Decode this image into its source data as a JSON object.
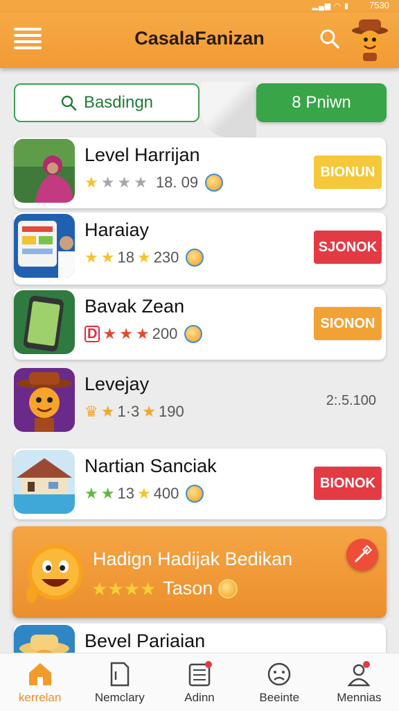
{
  "status": {
    "time": "7530"
  },
  "app": {
    "title": "CasalaFanizan"
  },
  "filters": {
    "search_label": "Basdingn",
    "green_label": "8 Pniwn"
  },
  "items": [
    {
      "title": "Level Harrijan",
      "rating_text": "18. 09",
      "button": "BIONUN"
    },
    {
      "title": "Haraiay",
      "count1": "18",
      "count2": "230",
      "button": "SJONOK"
    },
    {
      "title": "Bavak Zean",
      "count": "200",
      "button": "SIONON"
    },
    {
      "title": "Levejay",
      "count1": "1·3",
      "count2": "190",
      "value": "2:.5.100"
    },
    {
      "title": "Nartian Sanciak",
      "count1": "13",
      "count2": "400",
      "button": "BIONOK"
    },
    {
      "title": "Bevel Pariaian"
    }
  ],
  "promo": {
    "title": "Hadign Hadijak Bedikan",
    "subtitle": "Tason"
  },
  "nav": [
    {
      "label": "kerrelan",
      "icon": "home-icon"
    },
    {
      "label": "Nemclary",
      "icon": "document-icon"
    },
    {
      "label": "Adinn",
      "icon": "list-icon"
    },
    {
      "label": "Beeinte",
      "icon": "face-icon"
    },
    {
      "label": "Mennias",
      "icon": "profile-icon"
    }
  ],
  "colors": {
    "accent": "#f29b34",
    "green": "#38a548",
    "red": "#e33b44",
    "yellow": "#f4c83a"
  }
}
